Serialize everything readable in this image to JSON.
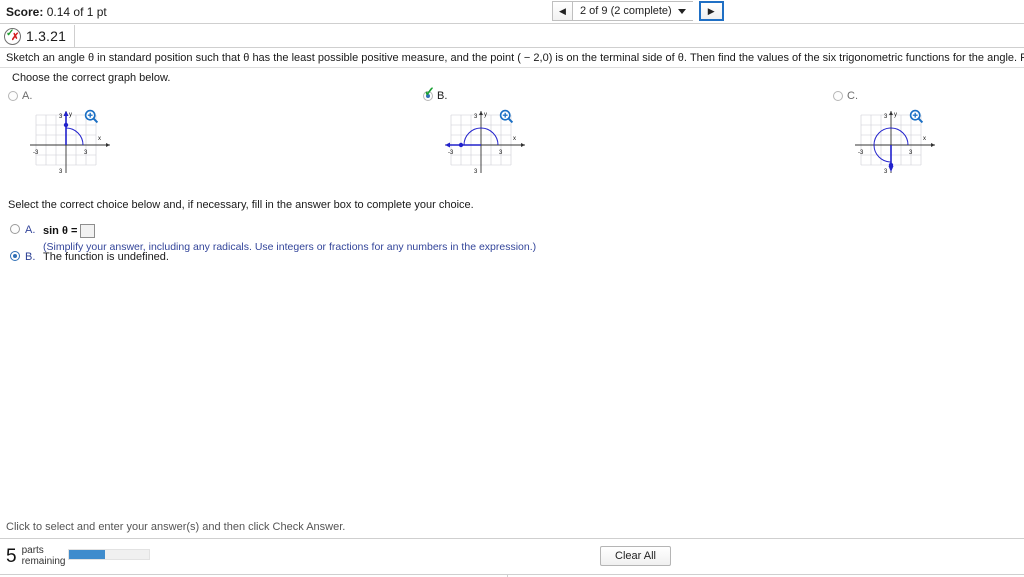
{
  "header": {
    "score_label": "Score:",
    "score_value": "0.14 of 1 pt",
    "nav_prev_icon": "triangle-left-icon",
    "nav_next_icon": "triangle-right-icon",
    "nav_position": "2 of 9 (2 complete)"
  },
  "problem": {
    "status_icon": "check-and-cross-icon",
    "id": "1.3.21",
    "statement": "Sketch an angle θ in standard position such that θ has the least possible positive measure, and the point ( − 2,0) is on the terminal side of θ. Then find the values of the six trigonometric functions for the angle. Rationalize denominators if applicable. Do not use a calculator.",
    "choose_prompt": "Choose the correct graph below."
  },
  "graph_options": [
    {
      "letter": "A.",
      "selected": false,
      "correct_mark": false,
      "zoom_icon": "magnifier-plus-icon",
      "graph": {
        "axis_max_label": "3",
        "axis_min_label": "-3",
        "x_label": "x",
        "y_label": "y",
        "angle_degrees": 90,
        "point": [
          0,
          2
        ]
      }
    },
    {
      "letter": "B.",
      "selected": true,
      "correct_mark": true,
      "zoom_icon": "magnifier-plus-icon",
      "graph": {
        "axis_max_label": "3",
        "axis_min_label": "-3",
        "x_label": "x",
        "y_label": "y",
        "angle_degrees": 180,
        "point": [
          -2,
          0
        ]
      }
    },
    {
      "letter": "C.",
      "selected": false,
      "correct_mark": false,
      "zoom_icon": "magnifier-plus-icon",
      "graph": {
        "axis_max_label": "3",
        "axis_min_label": "-3",
        "x_label": "x",
        "y_label": "y",
        "angle_degrees": 270,
        "point": [
          0,
          -2
        ]
      }
    }
  ],
  "answer": {
    "prompt": "Select the correct choice below and, if necessary, fill in the answer box to complete your choice.",
    "choices": [
      {
        "letter": "A.",
        "selected": false,
        "equation_label": "sin θ =",
        "input_value": "",
        "hint": "(Simplify your answer, including any radicals. Use integers or fractions for any numbers in the expression.)"
      },
      {
        "letter": "B.",
        "selected": true,
        "text": "The function is undefined."
      }
    ]
  },
  "footer": {
    "instruction": "Click to select and enter your answer(s) and then click Check Answer.",
    "parts_number": "5",
    "parts_label_line1": "parts",
    "parts_label_line2": "remaining",
    "progress_percent": 45,
    "clear_all_label": "Clear All"
  },
  "colors": {
    "accent_blue": "#2f6fb5",
    "graph_blue": "#2222cc",
    "progress_fill": "#3f8ccd",
    "link_blue": "#33459a",
    "green_check": "#1aa033",
    "red_cross": "#d32020"
  }
}
